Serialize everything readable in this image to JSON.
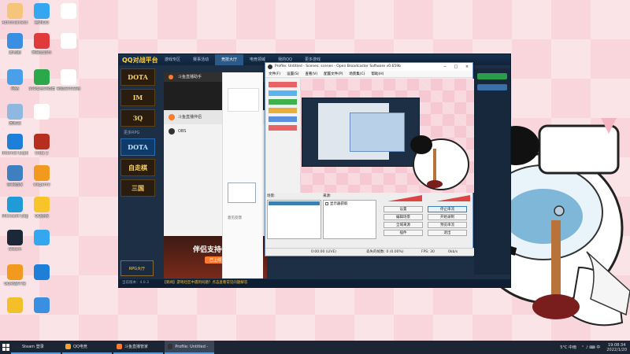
{
  "desktop_icons": [
    {
      "label": "Administrator",
      "color": "#f4c57a"
    },
    {
      "label": "腾讯QQ",
      "color": "#35a7f0"
    },
    {
      "label": "",
      "color": "#ffffff"
    },
    {
      "label": "此电脑",
      "color": "#3b8fe0"
    },
    {
      "label": "网易云音乐",
      "color": "#e03a3a"
    },
    {
      "label": "",
      "color": "#ffffff"
    },
    {
      "label": "网络",
      "color": "#4aa0e8"
    },
    {
      "label": "360安全浏览器",
      "color": "#2aa84a"
    },
    {
      "label": "新建文本文档",
      "color": "#ffffff"
    },
    {
      "label": "回收站",
      "color": "#8fb8e0"
    },
    {
      "label": "",
      "color": "#ffffff"
    },
    {
      "label": "Internet Explorer",
      "color": "#1e7fd8"
    },
    {
      "label": "Dota 2",
      "color": "#b82e1e"
    },
    {
      "label": "控制面板",
      "color": "#3d7fc1"
    },
    {
      "label": "wegame",
      "color": "#f29a1e"
    },
    {
      "label": "Microsoft Edge",
      "color": "#1f9bd8"
    },
    {
      "label": "QQ游戏",
      "color": "#f7c52a"
    },
    {
      "label": "Steam",
      "color": "#1b2838"
    },
    {
      "label": "",
      "color": "#35a7f0"
    },
    {
      "label": "QQ对战平台",
      "color": "#f29a1e"
    },
    {
      "label": "",
      "color": "#1e7fd8"
    },
    {
      "label": "",
      "color": "#f3c02a"
    },
    {
      "label": "",
      "color": "#3a8fe0"
    }
  ],
  "qq_window": {
    "logo": "QQ对战平台",
    "tabs": [
      "游戏专区",
      "赛事活动",
      "竞技大厅",
      "电竞领域",
      "我的QQ",
      "更多游戏"
    ],
    "active_tab": 2,
    "games": [
      "DOTA",
      "IM",
      "3Q",
      "DOTA",
      "自走棋",
      "三国"
    ],
    "side_label": "更多RPG",
    "rpg_button": "RPG大厅",
    "status_left": "当前版本：4.0.3",
    "status_notice": "【新闻】游戏社区中遇到问题？点击查看常见问题解答",
    "douyu": {
      "title": "斗鱼直播助手",
      "items": [
        "斗鱼直播伴侣",
        "OBS"
      ],
      "banner_title": "伴侣支持OBS",
      "banner_btn": "已上线",
      "feedback": "意见反馈"
    }
  },
  "obs": {
    "title": "Profile: Untitled - Scenes: scenes - Open Broadcaster Software v0.659b",
    "menu": [
      "文件(F)",
      "设置(S)",
      "查看(V)",
      "配置文件(P)",
      "场景集(C)",
      "帮助(H)"
    ],
    "scenes_label": "场景:",
    "sources_label": "来源:",
    "source_item": "显示器获取",
    "buttons": [
      "设置",
      "停止串流",
      "编辑场景",
      "开始录制",
      "全域来源",
      "预览串流",
      "插件",
      "退出"
    ],
    "status_time": "0:00:00 (LIVE)",
    "status_drop": "丢失的帧数: 0 (0.00%)",
    "status_fps": "FPS: 30",
    "status_rate": "0kb/s"
  },
  "taskbar": {
    "items": [
      {
        "label": "Steam 登录",
        "color": "#1b2838"
      },
      {
        "label": "QQ电竞",
        "color": "#f7a52a"
      },
      {
        "label": "斗鱼直播管家",
        "color": "#ff7a2a"
      },
      {
        "label": "Profile: Untitled - ...",
        "color": "#333333"
      }
    ],
    "active_index": 3,
    "weather": "5°C 中雨",
    "time": "19:08:34",
    "date": "2022/1/20"
  }
}
